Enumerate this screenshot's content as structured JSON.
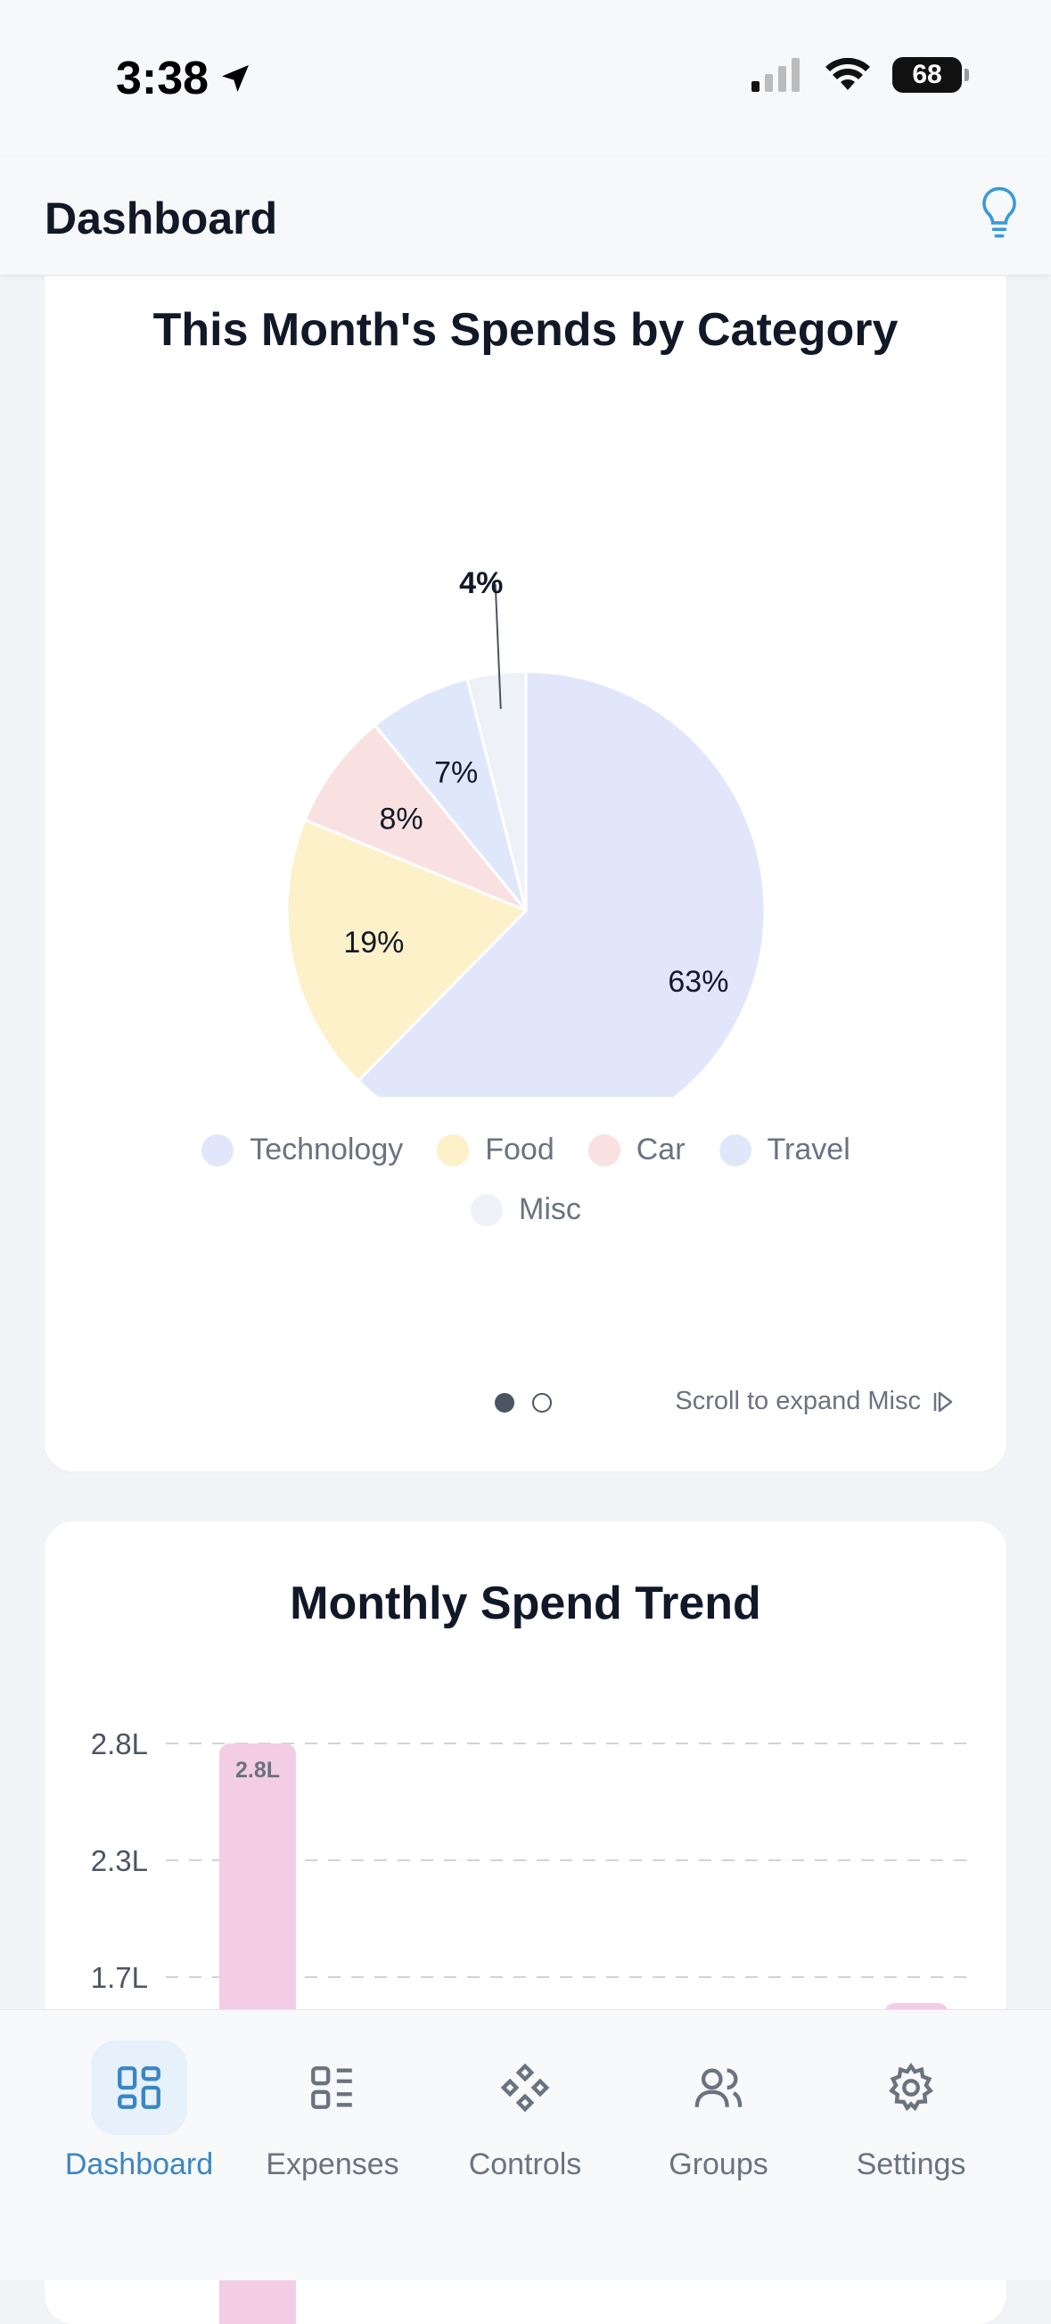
{
  "status": {
    "time": "3:38",
    "battery": "68"
  },
  "header": {
    "title": "Dashboard"
  },
  "card1": {
    "title": "This Month's Spends by Category",
    "hint": "Scroll to expand Misc"
  },
  "chart_data": [
    {
      "type": "pie",
      "title": "This Month's Spends by Category",
      "categories": [
        "Technology",
        "Food",
        "Car",
        "Travel",
        "Misc"
      ],
      "values": [
        63,
        19,
        8,
        7,
        4
      ],
      "labels": [
        "63%",
        "19%",
        "8%",
        "7%",
        "4%"
      ],
      "colors": [
        "#e1e6fb",
        "#fcf1c9",
        "#f9e1e1",
        "#dfe8fb",
        "#eef1f7"
      ],
      "legend": "bottom"
    },
    {
      "type": "bar",
      "title": "Monthly Spend Trend",
      "y_ticks": [
        "2.8L",
        "2.3L",
        "1.7L"
      ],
      "values": [
        2.8
      ],
      "data_labels": [
        "2.8L"
      ],
      "color": "#f3cde6",
      "grid": true
    }
  ],
  "card2": {
    "title": "Monthly Spend Trend"
  },
  "tabs": [
    {
      "label": "Dashboard",
      "icon": "dashboard-icon",
      "active": true
    },
    {
      "label": "Expenses",
      "icon": "list-icon",
      "active": false
    },
    {
      "label": "Controls",
      "icon": "controls-icon",
      "active": false
    },
    {
      "label": "Groups",
      "icon": "users-icon",
      "active": false
    },
    {
      "label": "Settings",
      "icon": "gear-icon",
      "active": false
    }
  ],
  "colors": {
    "accent": "#3a86c4",
    "text": "#111827",
    "muted": "#6b7280"
  }
}
